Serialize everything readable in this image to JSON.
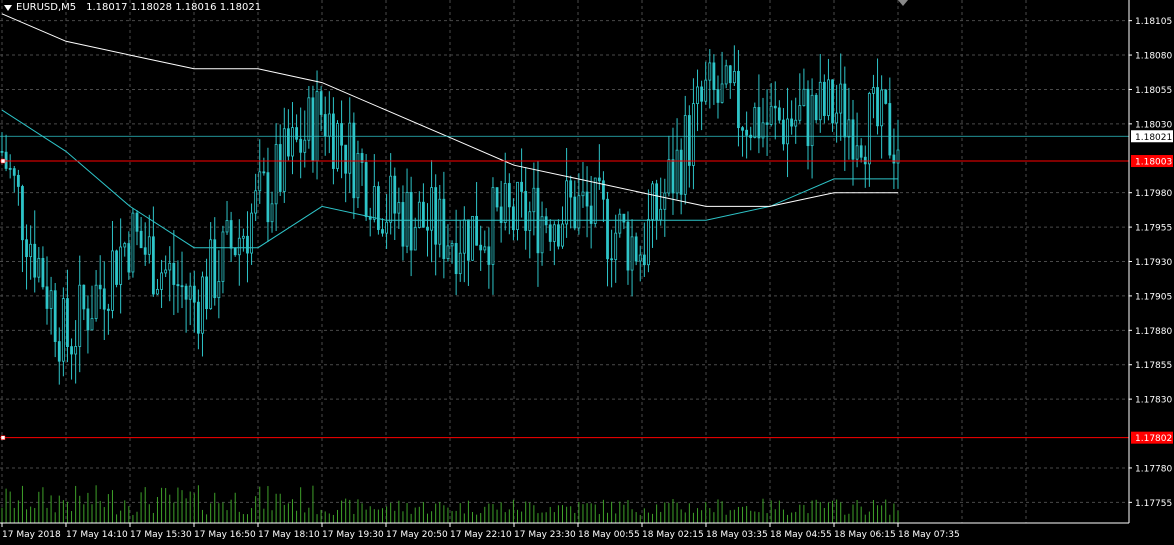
{
  "header": {
    "symbol_label": "EURUSD,M5",
    "ohlc_text": "1.18017 1.18028 1.18016 1.18021"
  },
  "price_axis": {
    "ticks": [
      "1.18105",
      "1.18080",
      "1.18055",
      "1.18030",
      "1.17980",
      "1.17955",
      "1.17930",
      "1.17905",
      "1.17880",
      "1.17855",
      "1.17830",
      "1.17780",
      "1.17755"
    ],
    "current_price_label": "1.18021",
    "hline_top_label": "1.18003",
    "hline_bottom_label": "1.17802"
  },
  "time_axis": {
    "labels": [
      "17 May 2018",
      "17 May 14:10",
      "17 May 15:30",
      "17 May 16:50",
      "17 May 18:10",
      "17 May 19:30",
      "17 May 20:50",
      "17 May 22:10",
      "17 May 23:30",
      "18 May 00:55",
      "18 May 02:15",
      "18 May 03:35",
      "18 May 04:55",
      "18 May 06:15",
      "18 May 07:35"
    ]
  },
  "colors": {
    "background": "#000000",
    "grid": "#4a4a4a",
    "candle": "#2ec4c8",
    "volume": "#3fa12a",
    "ma_slow": "#ffffff",
    "ma_fast": "#2ec4c8",
    "hline": "#ff0000",
    "axis_text": "#ffffff"
  },
  "chart_data": {
    "type": "line",
    "title": "EURUSD,M5",
    "ylim": [
      1.1774,
      1.1812
    ],
    "x": [
      "17 May 2018",
      "17 May 14:10",
      "17 May 15:30",
      "17 May 16:50",
      "17 May 18:10",
      "17 May 19:30",
      "17 May 20:50",
      "17 May 22:10",
      "17 May 23:30",
      "18 May 00:55",
      "18 May 02:15",
      "18 May 03:35",
      "18 May 04:55",
      "18 May 06:15",
      "18 May 07:35"
    ],
    "series": [
      {
        "values": [
          1.1801,
          1.1787,
          1.1795,
          1.179,
          1.1797,
          1.1804,
          1.1797,
          1.1795,
          1.1796,
          1.1797,
          1.1794,
          1.1805,
          1.1803,
          1.1804,
          1.1802
        ]
      },
      {
        "values": [
          1.1804,
          1.1801,
          1.1797,
          1.1794,
          1.1794,
          1.1797,
          1.1796,
          1.1796,
          1.1796,
          1.1796,
          1.1796,
          1.1796,
          1.1797,
          1.1799,
          1.1799
        ]
      },
      {
        "values": [
          1.1811,
          1.1809,
          1.1808,
          1.1807,
          1.1807,
          1.1806,
          1.1804,
          1.1802,
          1.18,
          1.1799,
          1.1798,
          1.1797,
          1.1797,
          1.1798,
          1.1798
        ]
      }
    ],
    "hlines": [
      1.18003,
      1.17802
    ],
    "current_price": 1.18021
  }
}
